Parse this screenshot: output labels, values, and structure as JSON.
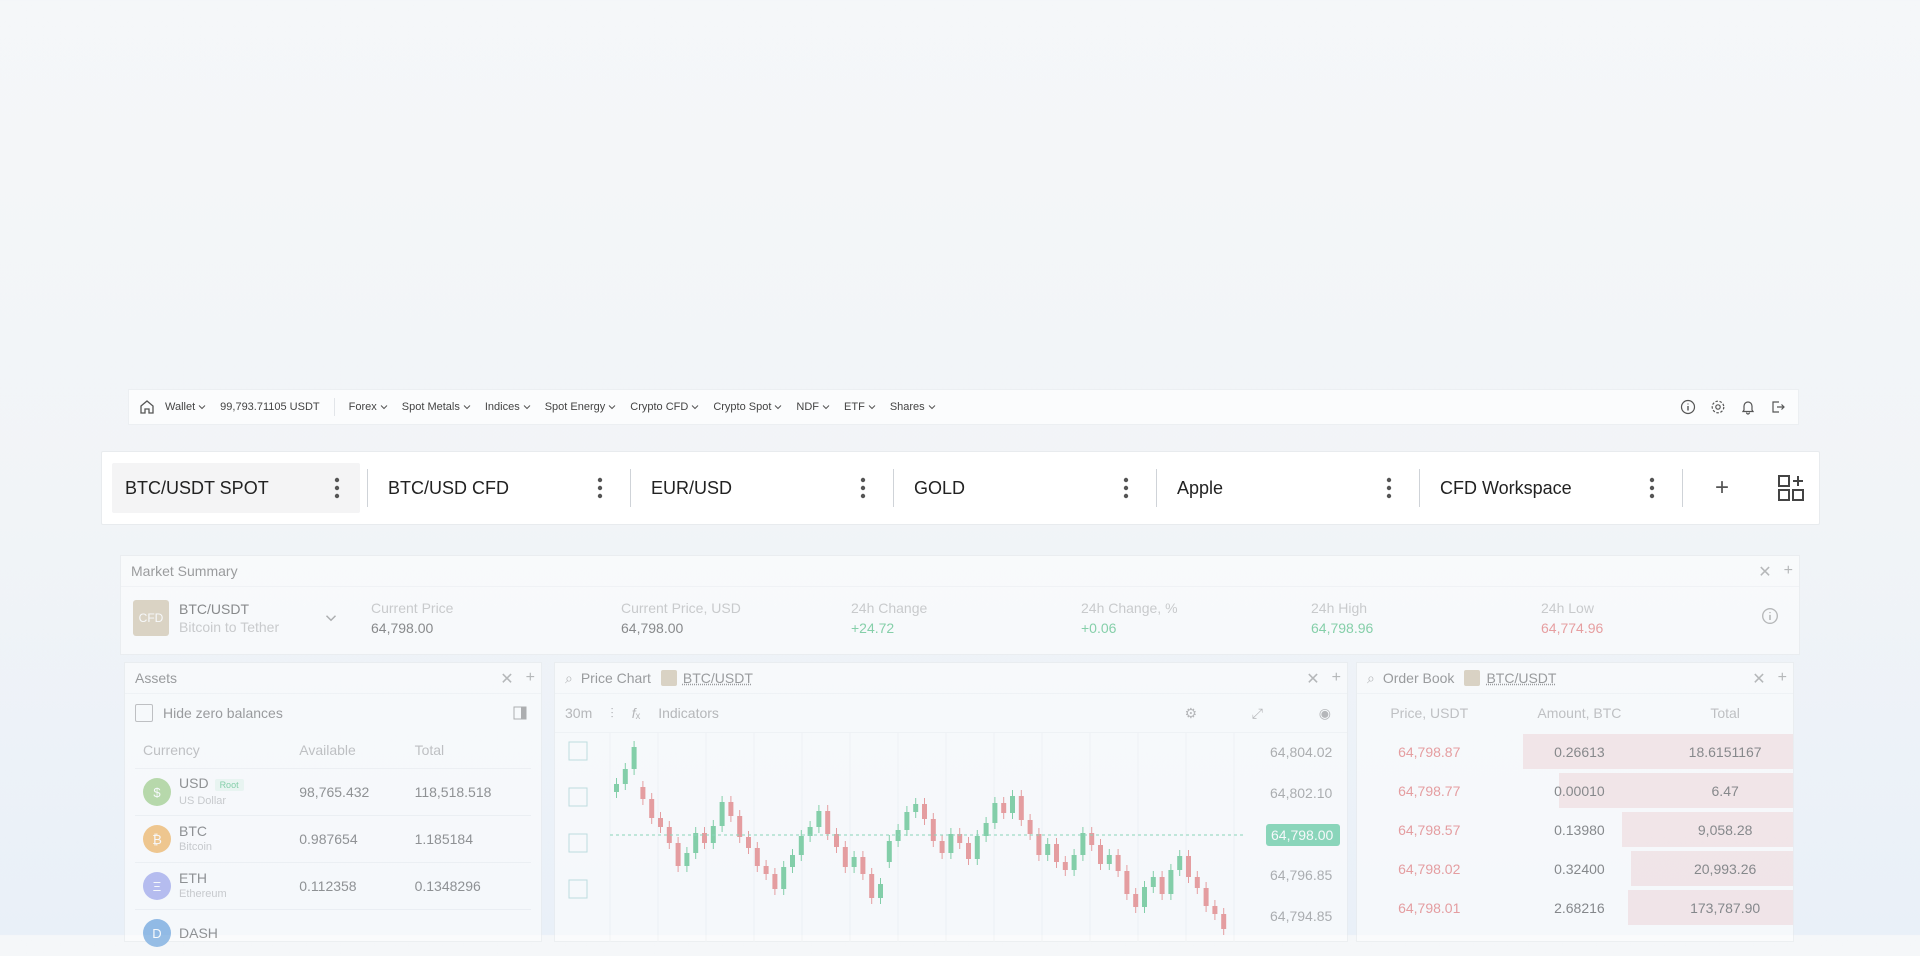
{
  "nav": {
    "wallet_label": "Wallet",
    "balance": "99,793.71105 USDT",
    "items": [
      "Forex",
      "Spot Metals",
      "Indices",
      "Spot Energy",
      "Crypto CFD",
      "Crypto Spot",
      "NDF",
      "ETF",
      "Shares"
    ],
    "right_icons": [
      "info-icon",
      "gear-icon",
      "bell-icon",
      "logout-icon"
    ]
  },
  "workspace_tabs": {
    "tabs": [
      "BTC/USDT SPOT",
      "BTC/USD CFD",
      "EUR/USD",
      "GOLD",
      "Apple",
      "CFD Workspace"
    ],
    "active_index": 0,
    "add_label": "+"
  },
  "market_summary": {
    "title": "Market Summary",
    "badge": "CFD",
    "pair": "BTC/USDT",
    "pair_desc": "Bitcoin to Tether",
    "stats": [
      {
        "label": "Current Price",
        "value": "64,798.00",
        "tone": "neutral"
      },
      {
        "label": "Current Price, USD",
        "value": "64,798.00",
        "tone": "neutral"
      },
      {
        "label": "24h Change",
        "value": "+24.72",
        "tone": "green"
      },
      {
        "label": "24h Change, %",
        "value": "+0.06",
        "tone": "green"
      },
      {
        "label": "24h High",
        "value": "64,798.96",
        "tone": "green"
      },
      {
        "label": "24h Low",
        "value": "64,774.96",
        "tone": "red"
      }
    ]
  },
  "assets": {
    "title": "Assets",
    "hide_zero_label": "Hide zero balances",
    "columns": [
      "Currency",
      "Available",
      "Total"
    ],
    "rows": [
      {
        "symbol": "USD",
        "name": "US Dollar",
        "available": "98,765.432",
        "total": "118,518.518",
        "badge": "Root",
        "color": "#8cc56e",
        "glyph": "$"
      },
      {
        "symbol": "BTC",
        "name": "Bitcoin",
        "available": "0.987654",
        "total": "1.185184",
        "badge": "",
        "color": "#f2a33a",
        "glyph": "₿"
      },
      {
        "symbol": "ETH",
        "name": "Ethereum",
        "available": "0.112358",
        "total": "0.1348296",
        "badge": "",
        "color": "#8b93e8",
        "glyph": "Ξ"
      },
      {
        "symbol": "DASH",
        "name": "",
        "available": "",
        "total": "",
        "badge": "",
        "color": "#4a8fd6",
        "glyph": "D"
      }
    ]
  },
  "price_chart": {
    "title": "Price Chart",
    "pair": "BTC/USDT",
    "timeframe": "30m",
    "indicators_label": "Indicators",
    "price_tag": "64,798.00",
    "y_ticks": [
      "64,804.02",
      "64,802.10",
      "64,798.85",
      "64,796.85",
      "64,794.85"
    ]
  },
  "order_book": {
    "title": "Order Book",
    "pair": "BTC/USDT",
    "columns": [
      "Price, USDT",
      "Amount, BTC",
      "Total"
    ],
    "rows": [
      {
        "price": "64,798.87",
        "amount": "0.26613",
        "total": "18.6151167",
        "depth": 0.9
      },
      {
        "price": "64,798.77",
        "amount": "0.00010",
        "total": "6.47",
        "depth": 0.78
      },
      {
        "price": "64,798.57",
        "amount": "0.13980",
        "total": "9,058.28",
        "depth": 0.57
      },
      {
        "price": "64,798.02",
        "amount": "0.32400",
        "total": "20,993.26",
        "depth": 0.54
      },
      {
        "price": "64,798.01",
        "amount": "2.68216",
        "total": "173,787.90",
        "depth": 0.55
      }
    ]
  },
  "colors": {
    "up": "#2fb36a",
    "down": "#e05a5a",
    "tag": "#3cbf88"
  }
}
